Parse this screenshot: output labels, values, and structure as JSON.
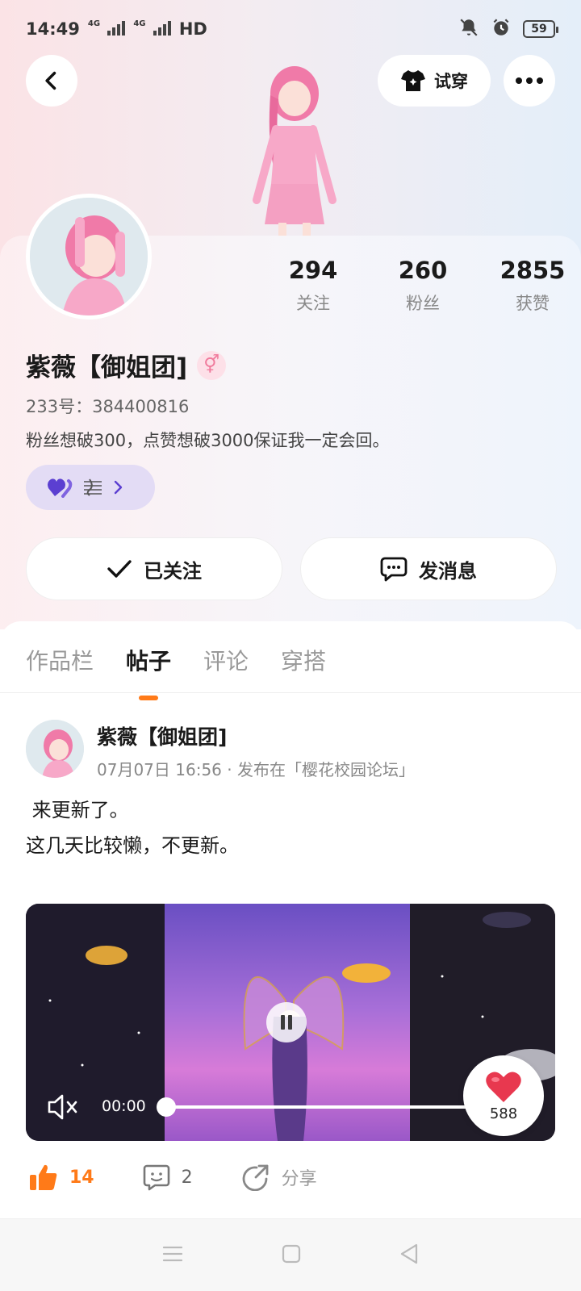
{
  "status_bar": {
    "time": "14:49",
    "network_1": "4G",
    "network_2": "4G",
    "hd_label": "HD",
    "battery": "59"
  },
  "header": {
    "try_on_label": "试穿"
  },
  "profile": {
    "name": "紫薇【御姐团]",
    "gender_symbol": "⚥",
    "uid_label": "233号：384400816",
    "bio": "粉丝想破300，点赞想破3000保证我一定会回。",
    "stats": [
      {
        "value": "294",
        "label": "关注"
      },
      {
        "value": "260",
        "label": "粉丝"
      },
      {
        "value": "2855",
        "label": "获赞"
      }
    ]
  },
  "actions": {
    "follow_label": "已关注",
    "message_label": "发消息"
  },
  "tabs": [
    "作品栏",
    "帖子",
    "评论",
    "穿搭"
  ],
  "active_tab": "帖子",
  "post": {
    "author": "紫薇【御姐团]",
    "meta": "07月07日 16:56 · 发布在「樱花校园论坛」",
    "text": " 来更新了。\n这几天比较懒，不更新。",
    "video": {
      "time": "00:00",
      "progress": 0,
      "likes": "588"
    },
    "like_count": "14",
    "comment_count": "2",
    "share_label": "分享"
  },
  "colors": {
    "accent": "#ff7a18",
    "pink": "#f07a9c",
    "badge_bg": "#e3dcf5",
    "heart": "#e8384f"
  }
}
